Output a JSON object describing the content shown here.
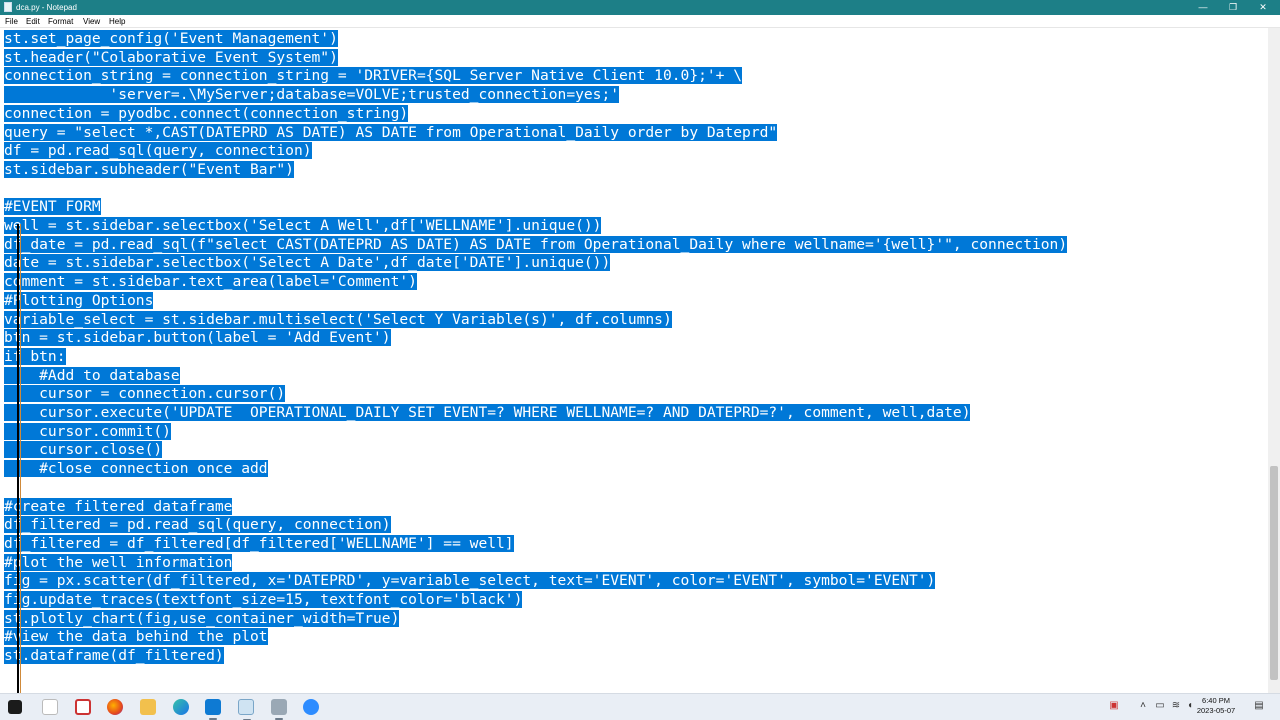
{
  "window": {
    "title": "dca.py - Notepad",
    "minimize": "—",
    "maximize": "❐",
    "close": "✕"
  },
  "menu": [
    "File",
    "Edit",
    "Format",
    "View",
    "Help"
  ],
  "code_lines": [
    "st.set_page_config('Event Management')",
    "st.header(\"Colaborative Event System\")",
    "connection_string = connection_string = 'DRIVER={SQL Server Native Client 10.0};'+ \\",
    "            'server=.\\MyServer;database=VOLVE;trusted_connection=yes;'",
    "connection = pyodbc.connect(connection_string)",
    "query = \"select *,CAST(DATEPRD AS DATE) AS DATE from Operational_Daily order by Dateprd\"",
    "df = pd.read_sql(query, connection)",
    "st.sidebar.subheader(\"Event Bar\")",
    "",
    "#EVENT FORM",
    "well = st.sidebar.selectbox('Select A Well',df['WELLNAME'].unique())",
    "df_date = pd.read_sql(f\"select CAST(DATEPRD AS DATE) AS DATE from Operational_Daily where wellname='{well}'\", connection)",
    "date = st.sidebar.selectbox('Select A Date',df_date['DATE'].unique())",
    "comment = st.sidebar.text_area(label='Comment')",
    "#Plotting Options",
    "variable_select = st.sidebar.multiselect('Select Y Variable(s)', df.columns)",
    "btn = st.sidebar.button(label = 'Add Event')",
    "if btn:",
    "    #Add to database",
    "    cursor = connection.cursor()",
    "    cursor.execute('UPDATE  OPERATIONAL_DAILY SET EVENT=? WHERE WELLNAME=? AND DATEPRD=?', comment, well,date)",
    "    cursor.commit()",
    "    cursor.close()",
    "    #close connection once add",
    "",
    "#create filtered dataframe",
    "df_filtered = pd.read_sql(query, connection)",
    "df_filtered = df_filtered[df_filtered['WELLNAME'] == well]",
    "#plot the well information",
    "fig = px.scatter(df_filtered, x='DATEPRD', y=variable_select, text='EVENT', color='EVENT', symbol='EVENT')",
    "fig.update_traces(textfont_size=15, textfont_color='black')",
    "st.plotly_chart(fig,use_container_width=True)",
    "#view the data behind the plot",
    "st.dataframe(df_filtered)"
  ],
  "selection_color": "#0078d7",
  "taskbar": {
    "icons": [
      "start-icon",
      "file-explorer-icon",
      "app-icon",
      "firefox-icon",
      "folder-icon",
      "edge-icon",
      "vscode-icon",
      "notepad-icon",
      "tool-icon",
      "zoom-icon"
    ]
  },
  "tray": {
    "time": "6:40 PM",
    "date": "2023-05-07"
  }
}
